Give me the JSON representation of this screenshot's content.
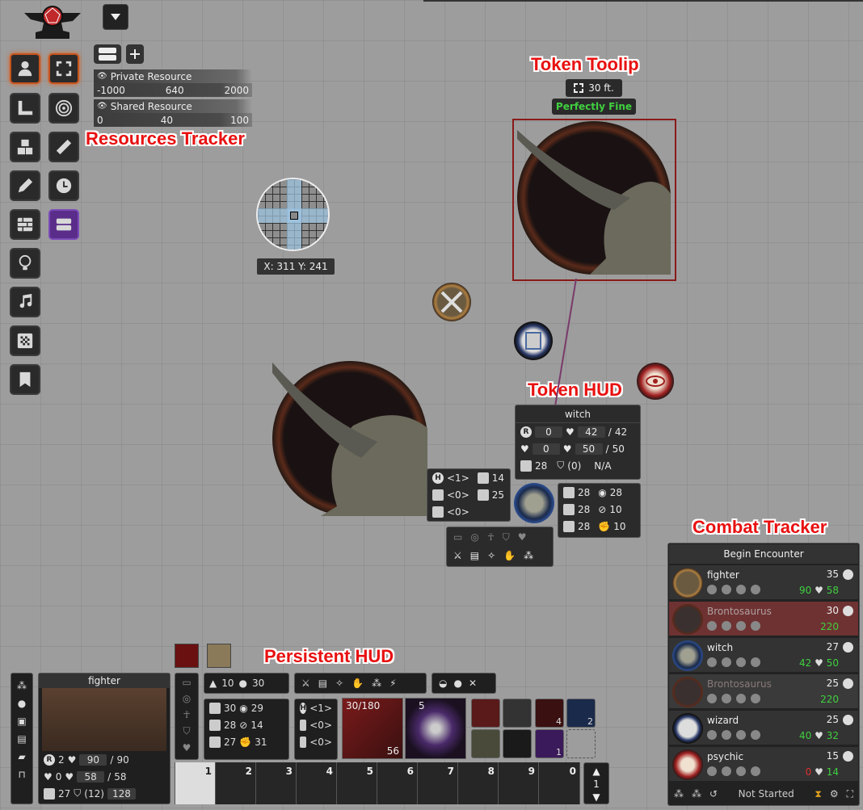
{
  "labels": {
    "resources_tracker": "Resources Tracker",
    "token_tooltip": "Token Toolip",
    "token_hud": "Token HUD",
    "combat_tracker": "Combat Tracker",
    "persistent_hud": "Persistent HUD"
  },
  "resources": {
    "private": {
      "title": "Private Resource",
      "min": "-1000",
      "value": "640",
      "max": "2000"
    },
    "shared": {
      "title": "Shared Resource",
      "min": "0",
      "value": "40",
      "max": "100"
    }
  },
  "ruler": {
    "coords": "X: 311 Y: 241"
  },
  "tooltip": {
    "distance": "30 ft.",
    "status": "Perfectly Fine"
  },
  "token_hud": {
    "name": "witch",
    "r": "0",
    "hp": "42",
    "hp_max": "42",
    "temp": "0",
    "hp2": "50",
    "hp2_max": "50",
    "ac": "28",
    "shield": "(0)",
    "na": "N/A",
    "left": {
      "h": "<1>",
      "stat1": "14",
      "stat2": "<0>",
      "stat3": "25",
      "stat4": "<0>"
    },
    "right": [
      [
        "28",
        "28"
      ],
      [
        "28",
        "10"
      ],
      [
        "28",
        "10"
      ]
    ]
  },
  "combat": {
    "title": "Begin Encounter",
    "rows": [
      {
        "name": "fighter",
        "init": "35",
        "hp": "90",
        "hp2": "58"
      },
      {
        "name": "Brontosaurus",
        "init": "30",
        "hp": "",
        "hp2": "220"
      },
      {
        "name": "witch",
        "init": "27",
        "hp": "42",
        "hp2": "50"
      },
      {
        "name": "Brontosaurus",
        "init": "25",
        "hp": "",
        "hp2": "220"
      },
      {
        "name": "wizard",
        "init": "25",
        "hp": "40",
        "hp2": "32"
      },
      {
        "name": "psychic",
        "init": "15",
        "hp": "0",
        "hp2": "14"
      }
    ],
    "footer": "Not Started"
  },
  "phud": {
    "name": "fighter",
    "r": "2",
    "hp": "90",
    "hp_max": "90",
    "temp": "0",
    "hp2": "58",
    "hp2_max": "58",
    "ac": "27",
    "shield": "(12)",
    "extra": "128",
    "move1": "10",
    "move2": "30",
    "stats": [
      [
        "30",
        "29"
      ],
      [
        "28",
        "14"
      ],
      [
        "27",
        "31"
      ]
    ],
    "mods": [
      "<1>",
      "<0>",
      "<0>"
    ],
    "weapon_ammo": "30/180",
    "weapon_count": "56",
    "shuriken": "5",
    "potion1": "4",
    "potion2": "2",
    "skull": "1",
    "hotbar": [
      "1",
      "2",
      "3",
      "4",
      "5",
      "6",
      "7",
      "8",
      "9",
      "0"
    ],
    "page": "1"
  }
}
